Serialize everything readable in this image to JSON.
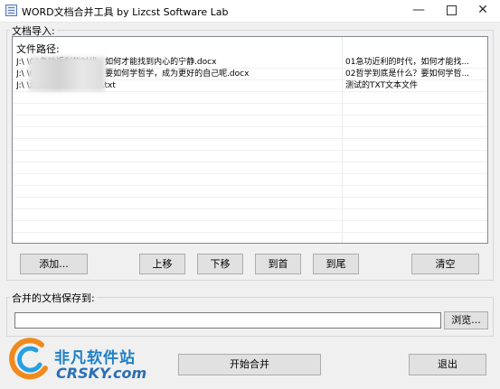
{
  "window": {
    "title": "WORD文档合并工具    by Lizcst Software Lab",
    "min_glyph": "—",
    "close_glyph": "✕"
  },
  "import_group": {
    "label": "文档导入:",
    "list_header": "文件路径:",
    "rows": [
      {
        "path": "J:\\          \\01急功近利的时代，如何才能找到内心的宁静.docx",
        "name": "01急功近利的时代，如何才能找..."
      },
      {
        "path": "J:\\          \\02哲学到底是什么？要如何学哲学，成为更好的自己呢.docx",
        "name": "02哲学到底是什么？要如何学哲..."
      },
      {
        "path": "J:\\          \\测试的TXT文本文件.txt",
        "name": "测试的TXT文本文件"
      }
    ]
  },
  "buttons": {
    "add": "添加...",
    "move_up": "上移",
    "move_down": "下移",
    "to_top": "到首",
    "to_bottom": "到尾",
    "clear": "清空",
    "browse": "浏览...",
    "start_merge": "开始合并",
    "exit": "退出"
  },
  "save_group": {
    "label": "合并的文档保存到:",
    "path_value": ""
  },
  "watermark": {
    "cn": "非凡软件站",
    "en": "CRSKY.com"
  },
  "colors": {
    "window_bg": "#f0f0f0",
    "button_bg": "#e1e1e1",
    "watermark_blue": "#1c7fc8"
  }
}
